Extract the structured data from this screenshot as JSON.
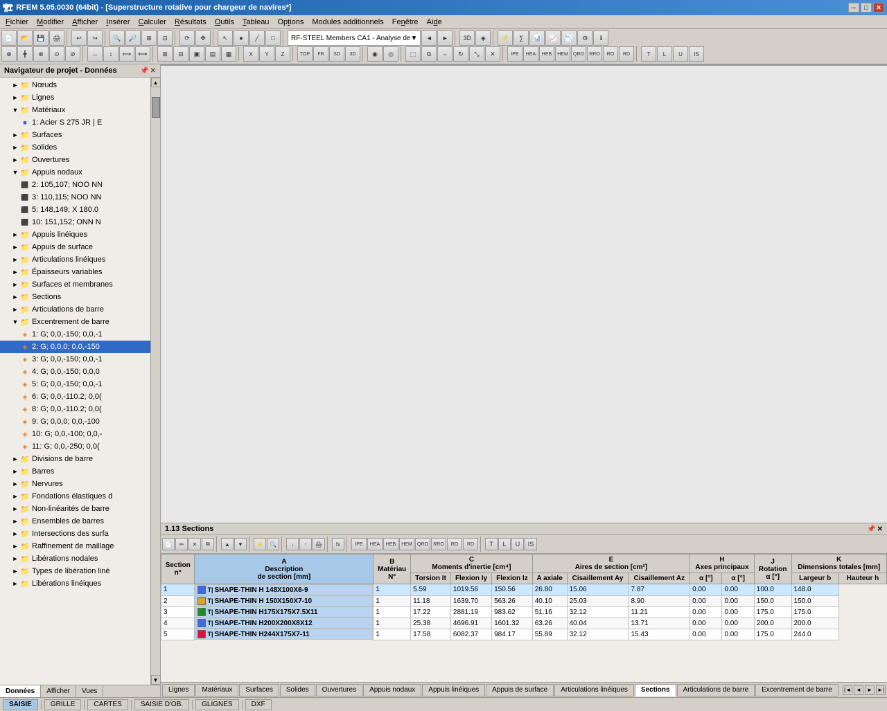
{
  "titleBar": {
    "title": "RFEM 5.05.0030 (64bit) - [Superstructure rotative pour chargeur de navires*]",
    "minimizeLabel": "─",
    "maximizeLabel": "□",
    "closeLabel": "✕",
    "innerMin": "─",
    "innerMax": "□",
    "innerClose": "✕"
  },
  "menuBar": {
    "items": [
      "Fichier",
      "Modifier",
      "Afficher",
      "Insérer",
      "Calculer",
      "Résultats",
      "Outils",
      "Tableau",
      "Options",
      "Modules additionnels",
      "Fenêtre",
      "Aide"
    ]
  },
  "toolbar": {
    "dropdownLabel": "RF-STEEL Members CA1 - Analyse de",
    "navArrows": [
      "◄",
      "►"
    ]
  },
  "navigator": {
    "title": "Navigateur de projet - Données",
    "tree": [
      {
        "id": "noeuds",
        "label": "Nœuds",
        "level": 0,
        "type": "folder",
        "expanded": false
      },
      {
        "id": "lignes",
        "label": "Lignes",
        "level": 0,
        "type": "folder",
        "expanded": false
      },
      {
        "id": "materiaux",
        "label": "Matériaux",
        "level": 0,
        "type": "folder",
        "expanded": true
      },
      {
        "id": "mat1",
        "label": "1: Acier S 275 JR | E",
        "level": 1,
        "type": "item-blue"
      },
      {
        "id": "surfaces",
        "label": "Surfaces",
        "level": 0,
        "type": "folder",
        "expanded": false
      },
      {
        "id": "solides",
        "label": "Solides",
        "level": 0,
        "type": "folder",
        "expanded": false
      },
      {
        "id": "ouvertures",
        "label": "Ouvertures",
        "level": 0,
        "type": "folder",
        "expanded": false
      },
      {
        "id": "appuis-nodaux",
        "label": "Appuis nodaux",
        "level": 0,
        "type": "folder",
        "expanded": true
      },
      {
        "id": "an2",
        "label": "2: 105,107; NOO NN",
        "level": 1,
        "type": "item-green"
      },
      {
        "id": "an3",
        "label": "3: 110,115; NOO NN",
        "level": 1,
        "type": "item-green"
      },
      {
        "id": "an5",
        "label": "5: 148,149; X 180.0",
        "level": 1,
        "type": "item-green"
      },
      {
        "id": "an10",
        "label": "10: 151,152; ONN N",
        "level": 1,
        "type": "item-green"
      },
      {
        "id": "appuis-lineiques",
        "label": "Appuis linéiques",
        "level": 0,
        "type": "folder",
        "expanded": false
      },
      {
        "id": "appuis-surface",
        "label": "Appuis de surface",
        "level": 0,
        "type": "folder",
        "expanded": false
      },
      {
        "id": "articulations-lineiques",
        "label": "Articulations linéiques",
        "level": 0,
        "type": "folder",
        "expanded": false
      },
      {
        "id": "epaisseurs-variables",
        "label": "Épaisseurs variables",
        "level": 0,
        "type": "folder",
        "expanded": false
      },
      {
        "id": "surfaces-membranes",
        "label": "Surfaces et membranes",
        "level": 0,
        "type": "folder",
        "expanded": false
      },
      {
        "id": "sections",
        "label": "Sections",
        "level": 0,
        "type": "folder",
        "expanded": false
      },
      {
        "id": "articulations-barre",
        "label": "Articulations de barre",
        "level": 0,
        "type": "folder",
        "expanded": false
      },
      {
        "id": "excentrement-barre",
        "label": "Excentrement de barre",
        "level": 0,
        "type": "folder",
        "expanded": true
      },
      {
        "id": "eb1",
        "label": "1: G; 0,0,-150; 0,0,-1",
        "level": 1,
        "type": "item-orange"
      },
      {
        "id": "eb2",
        "label": "2: G; 0,0,0; 0,0,-150",
        "level": 1,
        "type": "item-orange",
        "selected": true
      },
      {
        "id": "eb3",
        "label": "3: G; 0,0,-150; 0,0,-1",
        "level": 1,
        "type": "item-orange"
      },
      {
        "id": "eb4",
        "label": "4: G; 0,0,-150; 0,0,0",
        "level": 1,
        "type": "item-orange"
      },
      {
        "id": "eb5",
        "label": "5: G; 0,0,-150; 0,0,-1",
        "level": 1,
        "type": "item-orange"
      },
      {
        "id": "eb6",
        "label": "6: G; 0,0,-110.2; 0,0(",
        "level": 1,
        "type": "item-orange"
      },
      {
        "id": "eb8",
        "label": "8: G; 0,0,-110.2; 0,0(",
        "level": 1,
        "type": "item-orange"
      },
      {
        "id": "eb9",
        "label": "9: G; 0,0,0; 0,0,-100",
        "level": 1,
        "type": "item-orange"
      },
      {
        "id": "eb10",
        "label": "10: G; 0,0,-100; 0,0,-",
        "level": 1,
        "type": "item-orange"
      },
      {
        "id": "eb11",
        "label": "11: G; 0,0,-250; 0,0(",
        "level": 1,
        "type": "item-orange"
      },
      {
        "id": "divisions-barre",
        "label": "Divisions de barre",
        "level": 0,
        "type": "folder",
        "expanded": false
      },
      {
        "id": "barres",
        "label": "Barres",
        "level": 0,
        "type": "folder",
        "expanded": false
      },
      {
        "id": "nervures",
        "label": "Nervures",
        "level": 0,
        "type": "folder",
        "expanded": false
      },
      {
        "id": "fondations",
        "label": "Fondations élastiques d",
        "level": 0,
        "type": "folder",
        "expanded": false
      },
      {
        "id": "non-linearites",
        "label": "Non-linéarités de barre",
        "level": 0,
        "type": "folder",
        "expanded": false
      },
      {
        "id": "ensembles-barres",
        "label": "Ensembles de barres",
        "level": 0,
        "type": "folder",
        "expanded": false
      },
      {
        "id": "intersections-surfaces",
        "label": "Intersections des surfa",
        "level": 0,
        "type": "folder",
        "expanded": false
      },
      {
        "id": "raffinement",
        "label": "Raffinement de maillage",
        "level": 0,
        "type": "folder",
        "expanded": false
      },
      {
        "id": "liberations-nodales",
        "label": "Libérations nodales",
        "level": 0,
        "type": "folder",
        "expanded": false
      },
      {
        "id": "types-liberation-line",
        "label": "Types de libération liné",
        "level": 0,
        "type": "folder",
        "expanded": false
      },
      {
        "id": "liberations-lineiques",
        "label": "Libérations linéiques",
        "level": 0,
        "type": "folder",
        "expanded": false
      }
    ],
    "tabs": [
      "Données",
      "Afficher",
      "Vues"
    ]
  },
  "sectionsPanel": {
    "title": "1.13 Sections",
    "columns": {
      "section_no": "Section\nn°",
      "colA": "A\nDescription\nde section [mm]",
      "mat": "B\nMatériau\nN°",
      "torsionflex": "C\nMoments d'inertie [cm⁴]\nTorsion It",
      "flexionIy": "Flexion Iy",
      "flexionIz": "D\nFlexion Iz",
      "aAxiale": "E\nAires de section [cm²]\nA axiale",
      "cisaillement1": "F\nCisaillement Ay",
      "cisaillement2": "G\nCisaillement Az",
      "axePrincipal": "H\nAxes principaux\nα [°]",
      "rotation": "J\nRotation\nα [°]",
      "dimLargeur": "K\nDimensions totales [mm]\nLargeur b",
      "dimHauteur": "L\nHauteur h"
    },
    "rows": [
      {
        "no": 1,
        "color": "#4169E1",
        "shape": "T|",
        "description": "SHAPE-THIN H 148X100X6-9",
        "mat": 1,
        "torsion": "5.59",
        "flexionIy": "1019.56",
        "flexionIz": "150.56",
        "aAxiale": "26.80",
        "cisaillement1": "15.06",
        "cisaillement2": "7.87",
        "axePrinc": "0.00",
        "rotation": "0.00",
        "largeur": "100.0",
        "hauteur": "148.0"
      },
      {
        "no": 2,
        "color": "#DAA520",
        "shape": "T|",
        "description": "SHAPE-THIN H 150X150X7-10",
        "mat": 1,
        "torsion": "11.18",
        "flexionIy": "1639.70",
        "flexionIz": "563.26",
        "aAxiale": "40.10",
        "cisaillement1": "25.03",
        "cisaillement2": "8.90",
        "axePrinc": "0.00",
        "rotation": "0.00",
        "largeur": "150.0",
        "hauteur": "150.0"
      },
      {
        "no": 3,
        "color": "#228B22",
        "shape": "T|",
        "description": "SHAPE-THIN H175X175X7.5X11",
        "mat": 1,
        "torsion": "17.22",
        "flexionIy": "2881.19",
        "flexionIz": "983.62",
        "aAxiale": "51.16",
        "cisaillement1": "32.12",
        "cisaillement2": "11.21",
        "axePrinc": "0.00",
        "rotation": "0.00",
        "largeur": "175.0",
        "hauteur": "175.0"
      },
      {
        "no": 4,
        "color": "#4169E1",
        "shape": "T|",
        "description": "SHAPE-THIN H200X200X8X12",
        "mat": 1,
        "torsion": "25.38",
        "flexionIy": "4696.91",
        "flexionIz": "1601.32",
        "aAxiale": "63.26",
        "cisaillement1": "40.04",
        "cisaillement2": "13.71",
        "axePrinc": "0.00",
        "rotation": "0.00",
        "largeur": "200.0",
        "hauteur": "200.0"
      },
      {
        "no": 5,
        "color": "#DC143C",
        "shape": "T|",
        "description": "SHAPE-THIN H244X175X7-11",
        "mat": 1,
        "torsion": "17.58",
        "flexionIy": "6082.37",
        "flexionIz": "984.17",
        "aAxiale": "55.89",
        "cisaillement1": "32.12",
        "cisaillement2": "15.43",
        "axePrinc": "0.00",
        "rotation": "0.00",
        "largeur": "175.0",
        "hauteur": "244.0"
      }
    ]
  },
  "bottomTabs": [
    "Lignes",
    "Matériaux",
    "Surfaces",
    "Solides",
    "Ouvertures",
    "Appuis nodaux",
    "Appuis linéiques",
    "Appuis de surface",
    "Articulations linéiques",
    "Sections",
    "Articulations de barre",
    "Excentrement de barre"
  ],
  "statusBar": {
    "tabs": [
      "SAISIE",
      "GRILLE",
      "CARTES",
      "SAISIE D'OB.",
      "GLIGNES",
      "DXF"
    ]
  },
  "viewport": {
    "title": ""
  }
}
